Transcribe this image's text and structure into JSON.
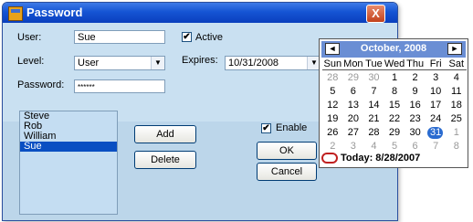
{
  "window": {
    "title": "Password",
    "close_glyph": "X"
  },
  "form": {
    "user_label": "User:",
    "user_value": "Sue",
    "active_label": "Active",
    "active_checked": true,
    "level_label": "Level:",
    "level_value": "User",
    "expires_label": "Expires:",
    "expires_value": "10/31/2008",
    "password_label": "Password:",
    "password_value": "******"
  },
  "users": {
    "items": [
      "Steve",
      "Rob",
      "William",
      "Sue"
    ],
    "selected": "Sue"
  },
  "buttons": {
    "add": "Add",
    "delete": "Delete",
    "ok": "OK",
    "cancel": "Cancel"
  },
  "enable": {
    "label": "Enable",
    "checked": true
  },
  "calendar": {
    "month_label": "October, 2008",
    "prev_glyph": "◄",
    "next_glyph": "►",
    "weekdays": [
      "Sun",
      "Mon",
      "Tue",
      "Wed",
      "Thu",
      "Fri",
      "Sat"
    ],
    "weeks": [
      [
        "28",
        "29",
        "30",
        "1",
        "2",
        "3",
        "4"
      ],
      [
        "5",
        "6",
        "7",
        "8",
        "9",
        "10",
        "11"
      ],
      [
        "12",
        "13",
        "14",
        "15",
        "16",
        "17",
        "18"
      ],
      [
        "19",
        "20",
        "21",
        "22",
        "23",
        "24",
        "25"
      ],
      [
        "26",
        "27",
        "28",
        "29",
        "30",
        "31",
        "1"
      ],
      [
        "2",
        "3",
        "4",
        "5",
        "6",
        "7",
        "8"
      ]
    ],
    "selected_day": "31",
    "today_label": "Today: 8/28/2007"
  },
  "colors": {
    "titlebar": "#1554d4",
    "form_bg": "#c9e0f1",
    "selection": "#0a4fc2",
    "close": "#c2411c",
    "calendar_header": "#6a8ed4"
  }
}
